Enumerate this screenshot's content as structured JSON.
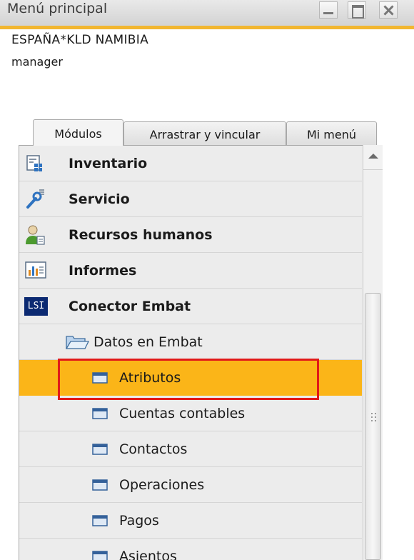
{
  "window": {
    "title": "Menú principal"
  },
  "header": {
    "company": "ESPAÑA*KLD NAMIBIA",
    "user": "manager"
  },
  "tabs": [
    {
      "label": "Módulos",
      "active": true
    },
    {
      "label": "Arrastrar y vincular",
      "active": false
    },
    {
      "label": "Mi menú",
      "active": false
    }
  ],
  "menu": {
    "modules": [
      {
        "label": "Inventario",
        "icon": "inventory-icon"
      },
      {
        "label": "Servicio",
        "icon": "service-icon"
      },
      {
        "label": "Recursos humanos",
        "icon": "human-resources-icon"
      },
      {
        "label": "Informes",
        "icon": "reports-icon"
      },
      {
        "label": "Conector Embat",
        "icon": "lsi-logo-icon",
        "icon_text": "LSI"
      }
    ],
    "folder": {
      "label": "Datos en Embat",
      "icon": "open-folder-icon"
    },
    "items": [
      {
        "label": "Atributos",
        "selected": true,
        "icon": "form-icon"
      },
      {
        "label": "Cuentas contables",
        "icon": "form-icon"
      },
      {
        "label": "Contactos",
        "icon": "form-icon"
      },
      {
        "label": "Operaciones",
        "icon": "form-icon"
      },
      {
        "label": "Pagos",
        "icon": "form-icon"
      },
      {
        "label": "Asientos",
        "icon": "form-icon"
      }
    ]
  },
  "colors": {
    "accent": "#f2b630",
    "selected_row": "#fbb518",
    "highlight_border": "#e11919",
    "lsi_bg": "#0c2a72"
  }
}
